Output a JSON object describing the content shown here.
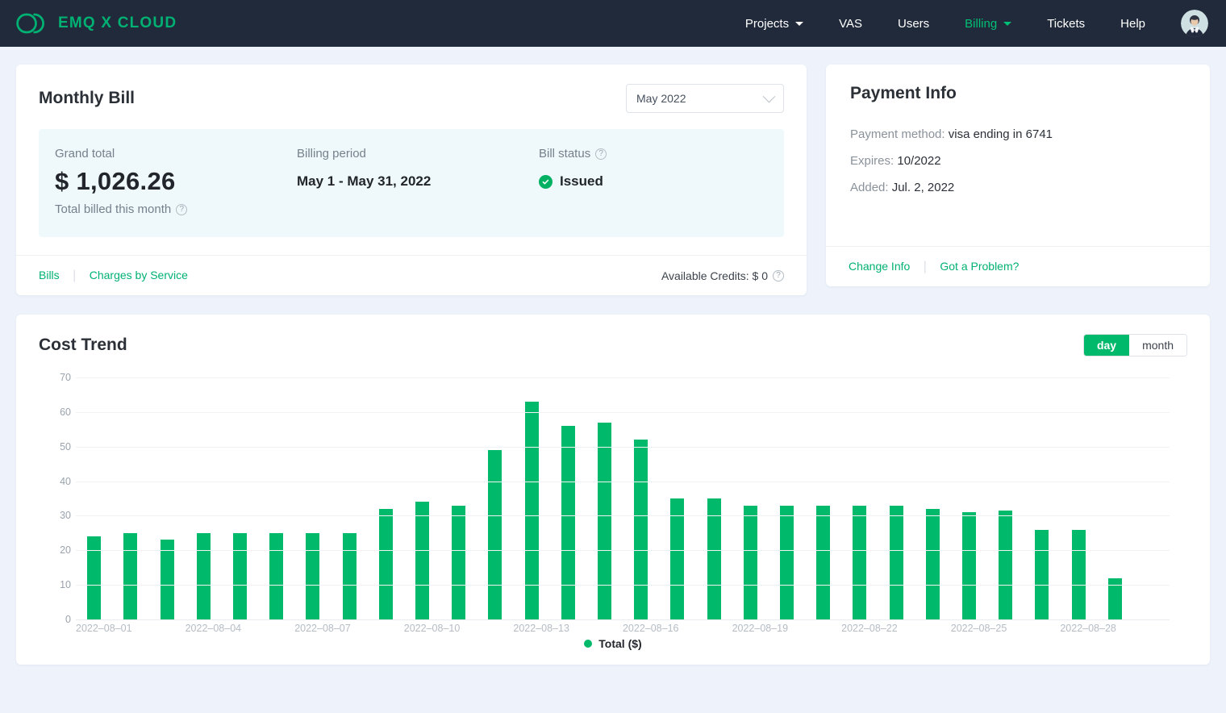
{
  "navbar": {
    "brand": "EMQ X CLOUD",
    "logo_icon": "emqx-logo-icon",
    "items": [
      {
        "label": "Projects",
        "has_caret": true,
        "active": false
      },
      {
        "label": "VAS",
        "has_caret": false,
        "active": false
      },
      {
        "label": "Users",
        "has_caret": false,
        "active": false
      },
      {
        "label": "Billing",
        "has_caret": true,
        "active": true
      },
      {
        "label": "Tickets",
        "has_caret": false,
        "active": false
      },
      {
        "label": "Help",
        "has_caret": false,
        "active": false
      }
    ],
    "avatar_icon": "user-avatar"
  },
  "monthly_bill": {
    "title": "Monthly Bill",
    "month_selector": {
      "value": "May  2022",
      "icon": "chevron-down-icon"
    },
    "grand_total": {
      "label": "Grand total",
      "value": "$ 1,026.26",
      "sub_label": "Total billed this month",
      "help_icon": "help-circle-icon"
    },
    "billing_period": {
      "label": "Billing period",
      "value": "May 1 - May 31, 2022"
    },
    "bill_status": {
      "label": "Bill status",
      "help_icon": "help-circle-icon",
      "value": "Issued",
      "status_icon": "check-circle-icon"
    },
    "footer": {
      "links": [
        "Bills",
        "Charges by Service"
      ],
      "separator": "|",
      "credits_label": "Available Credits: $ 0",
      "credits_help_icon": "help-circle-icon"
    }
  },
  "payment_info": {
    "title": "Payment Info",
    "rows": [
      {
        "label": "Payment method:",
        "value": "visa ending in 6741"
      },
      {
        "label": "Expires:",
        "value": "10/2022"
      },
      {
        "label": "Added:",
        "value": "Jul. 2, 2022"
      }
    ],
    "footer": {
      "links": [
        "Change Info",
        "Got a Problem?"
      ],
      "separator": "|"
    }
  },
  "cost_trend": {
    "title": "Cost Trend",
    "toggle": {
      "options": [
        "day",
        "month"
      ],
      "selected": "day"
    }
  },
  "chart_data": {
    "type": "bar",
    "title": "Cost Trend",
    "xlabel": "",
    "ylabel": "",
    "ylim": [
      0,
      70
    ],
    "yticks": [
      0,
      10,
      20,
      30,
      40,
      50,
      60,
      70
    ],
    "grid": true,
    "legend": [
      "Total ($)"
    ],
    "legend_position": "bottom",
    "bar_color": "#00b96b",
    "categories": [
      "2022-08-01",
      "2022-08-02",
      "2022-08-03",
      "2022-08-04",
      "2022-08-05",
      "2022-08-06",
      "2022-08-07",
      "2022-08-08",
      "2022-08-09",
      "2022-08-10",
      "2022-08-11",
      "2022-08-12",
      "2022-08-13",
      "2022-08-14",
      "2022-08-15",
      "2022-08-16",
      "2022-08-17",
      "2022-08-18",
      "2022-08-19",
      "2022-08-20",
      "2022-08-21",
      "2022-08-22",
      "2022-08-23",
      "2022-08-24",
      "2022-08-25",
      "2022-08-26",
      "2022-08-27",
      "2022-08-28",
      "2022-08-29",
      "2022-08-30"
    ],
    "tick_labels": [
      "2022-08-01",
      "",
      "",
      "2022-08-04",
      "",
      "",
      "2022-08-07",
      "",
      "",
      "2022-08-10",
      "",
      "",
      "2022-08-13",
      "",
      "",
      "2022-08-16",
      "",
      "",
      "2022-08-19",
      "",
      "",
      "2022-08-22",
      "",
      "",
      "2022-08-25",
      "",
      "",
      "2022-08-28",
      "",
      ""
    ],
    "series": [
      {
        "name": "Total ($)",
        "values": [
          24,
          25,
          23,
          25,
          25,
          25,
          25,
          25,
          32,
          34,
          33,
          49,
          63,
          56,
          57,
          52,
          35,
          35,
          33,
          33,
          33,
          33,
          33,
          32,
          31,
          31.5,
          26,
          26,
          12,
          0
        ]
      }
    ]
  }
}
